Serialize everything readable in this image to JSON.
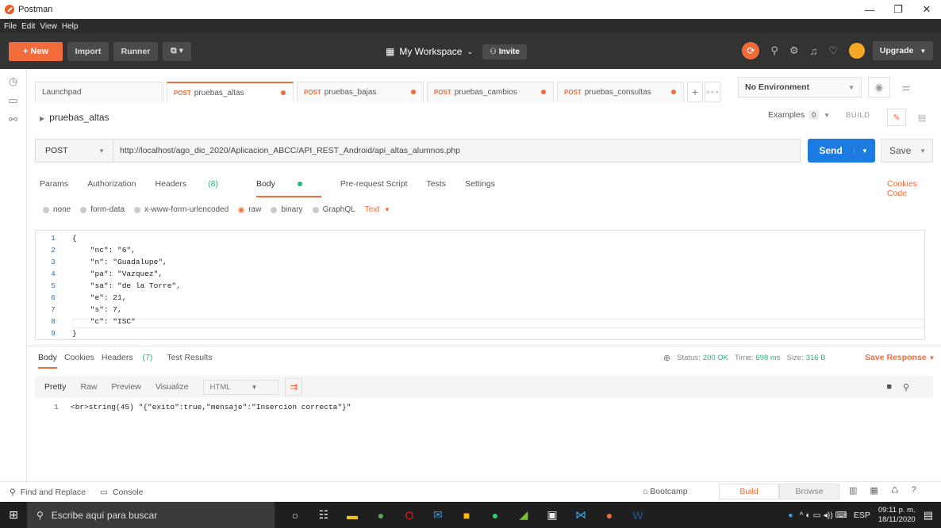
{
  "window": {
    "title": "Postman",
    "controls": [
      "—",
      "❐",
      "✕"
    ]
  },
  "menu": [
    "File",
    "Edit",
    "View",
    "Help"
  ],
  "toolbar": {
    "new_label": "+ New",
    "import_label": "Import",
    "runner_label": "Runner",
    "workspace_label": "My Workspace",
    "invite_label": "Invite",
    "upgrade_label": "Upgrade"
  },
  "tabs": [
    {
      "label": "Launchpad",
      "method": ""
    },
    {
      "label": "pruebas_altas",
      "method": "POST"
    },
    {
      "label": "pruebas_bajas",
      "method": "POST"
    },
    {
      "label": "pruebas_cambios",
      "method": "POST"
    },
    {
      "label": "pruebas_consultas",
      "method": "POST"
    }
  ],
  "environment": "No Environment",
  "request": {
    "name": "pruebas_altas",
    "examples_label": "Examples",
    "examples_count": "0",
    "build_label": "BUILD",
    "method": "POST",
    "url": "http://localhost/ago_dic_2020/Aplicacion_ABCC/API_REST_Android/api_altas_alumnos.php",
    "send_label": "Send",
    "save_label": "Save"
  },
  "request_tabs": [
    "Params",
    "Authorization",
    "Headers",
    "(8)",
    "Body",
    "Pre-request Script",
    "Tests",
    "Settings"
  ],
  "cookies_label": "Cookies",
  "code_label": "Code",
  "body_types": [
    "none",
    "form-data",
    "x-www-form-urlencoded",
    "raw",
    "binary",
    "GraphQL"
  ],
  "body_format": "Text",
  "body_lines": [
    {
      "n": "1",
      "code": "{"
    },
    {
      "n": "2",
      "code": "    \"nc\": \"6\","
    },
    {
      "n": "3",
      "code": "    \"n\": \"Guadalupe\","
    },
    {
      "n": "4",
      "code": "    \"pa\": \"Vazquez\","
    },
    {
      "n": "5",
      "code": "    \"sa\": \"de la Torre\","
    },
    {
      "n": "6",
      "code": "    \"e\": 21,"
    },
    {
      "n": "7",
      "code": "    \"s\": 7,"
    },
    {
      "n": "8",
      "code": "    \"c\": \"ISC\""
    },
    {
      "n": "9",
      "code": "}"
    }
  ],
  "response_tabs": [
    "Body",
    "Cookies",
    "Headers",
    "(7)",
    "Test Results"
  ],
  "response_status": {
    "status_label": "Status:",
    "status": "200 OK",
    "time_label": "Time:",
    "time": "698 ms",
    "size_label": "Size:",
    "size": "316 B",
    "save_response": "Save Response"
  },
  "view_modes": [
    "Pretty",
    "Raw",
    "Preview",
    "Visualize"
  ],
  "view_lang": "HTML",
  "response_line": {
    "n": "1",
    "code": "<br>string(45) \"{\"exito\":true,\"mensaje\":\"Insercion correcta\"}\""
  },
  "statusbar": {
    "find_replace": "Find and Replace",
    "console": "Console",
    "bootcamp": "Bootcamp",
    "build": "Build",
    "browse": "Browse"
  },
  "taskbar": {
    "search_placeholder": "Escribe aquí para buscar",
    "lang": "ESP",
    "time": "09:11 p. m.",
    "date": "18/11/2020"
  },
  "colors": {
    "accent": "#f26b3a",
    "send": "#1b7be0",
    "success": "#26b47f"
  }
}
